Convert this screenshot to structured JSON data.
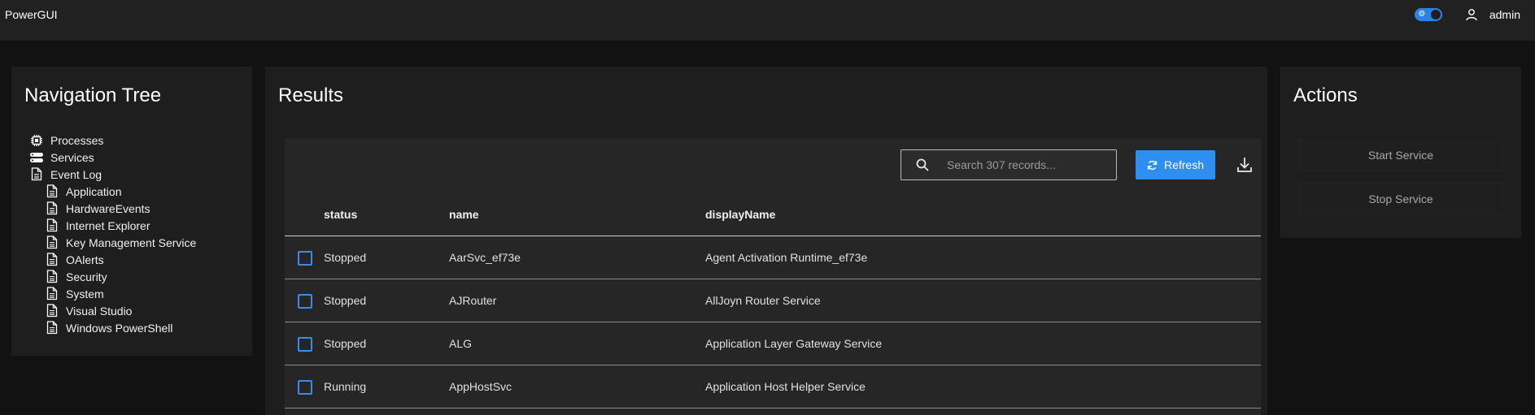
{
  "app": {
    "title": "PowerGUI",
    "user": "admin"
  },
  "nav": {
    "title": "Navigation Tree",
    "items": [
      {
        "label": "Processes",
        "icon": "cpu-icon",
        "level": 0
      },
      {
        "label": "Services",
        "icon": "server-icon",
        "level": 0
      },
      {
        "label": "Event Log",
        "icon": "document-icon",
        "level": 0
      },
      {
        "label": "Application",
        "icon": "document-icon",
        "level": 1
      },
      {
        "label": "HardwareEvents",
        "icon": "document-icon",
        "level": 1
      },
      {
        "label": "Internet Explorer",
        "icon": "document-icon",
        "level": 1
      },
      {
        "label": "Key Management Service",
        "icon": "document-icon",
        "level": 1
      },
      {
        "label": "OAlerts",
        "icon": "document-icon",
        "level": 1
      },
      {
        "label": "Security",
        "icon": "document-icon",
        "level": 1
      },
      {
        "label": "System",
        "icon": "document-icon",
        "level": 1
      },
      {
        "label": "Visual Studio",
        "icon": "document-icon",
        "level": 1
      },
      {
        "label": "Windows PowerShell",
        "icon": "document-icon",
        "level": 1
      }
    ]
  },
  "results": {
    "title": "Results",
    "search_placeholder": "Search 307 records...",
    "refresh_label": "Refresh",
    "columns": [
      "status",
      "name",
      "displayName"
    ],
    "rows": [
      {
        "status": "Stopped",
        "name": "AarSvc_ef73e",
        "displayName": "Agent Activation Runtime_ef73e"
      },
      {
        "status": "Stopped",
        "name": "AJRouter",
        "displayName": "AllJoyn Router Service"
      },
      {
        "status": "Stopped",
        "name": "ALG",
        "displayName": "Application Layer Gateway Service"
      },
      {
        "status": "Running",
        "name": "AppHostSvc",
        "displayName": "Application Host Helper Service"
      }
    ]
  },
  "actions": {
    "title": "Actions",
    "start_label": "Start Service",
    "stop_label": "Stop Service"
  },
  "colors": {
    "accent": "#2e8ff0",
    "panel": "#1e1e1e",
    "appbar": "#212121"
  }
}
